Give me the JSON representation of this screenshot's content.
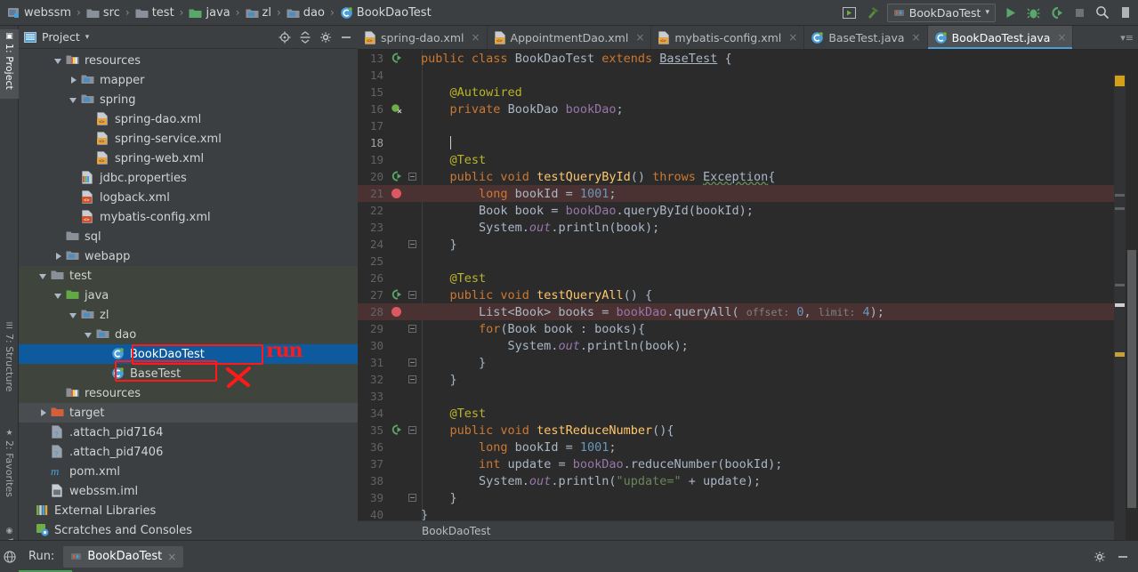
{
  "window": {
    "breadcrumbs": [
      {
        "label": "webssm",
        "icon": "module-icon"
      },
      {
        "label": "src",
        "icon": "folder-icon"
      },
      {
        "label": "test",
        "icon": "folder-icon"
      },
      {
        "label": "java",
        "icon": "source-folder-icon"
      },
      {
        "label": "zl",
        "icon": "package-icon"
      },
      {
        "label": "dao",
        "icon": "package-icon"
      },
      {
        "label": "BookDaoTest",
        "icon": "java-class-icon"
      }
    ],
    "separator": "›"
  },
  "toolbar": {
    "run_configuration": "BookDaoTest",
    "dropdown_glyph": "▾",
    "buttons": [
      {
        "name": "select-run-config-icon",
        "label": ""
      },
      {
        "name": "build-hammer-icon",
        "label": ""
      },
      {
        "name": "run-button",
        "label": "Run"
      },
      {
        "name": "debug-button",
        "label": "Debug"
      },
      {
        "name": "run-with-coverage-button",
        "label": "Run with Coverage"
      },
      {
        "name": "stop-button",
        "label": "Stop"
      },
      {
        "name": "search-everywhere-icon",
        "label": "Search"
      }
    ]
  },
  "left_tool_strip": [
    {
      "label": "1: Project",
      "selected": true
    },
    {
      "label": "7: Structure",
      "selected": false
    },
    {
      "label": "2: Favorites",
      "selected": false
    },
    {
      "label": "Web",
      "selected": false
    }
  ],
  "project_panel": {
    "title": "Project",
    "dropdown_glyph": "▾",
    "actions": [
      "locate-icon",
      "collapse-all-icon",
      "settings-gear-icon",
      "hide-icon"
    ],
    "tree": [
      {
        "label": "resources",
        "indent": 2,
        "arrow": "open",
        "icon": "resource-folder-icon"
      },
      {
        "label": "mapper",
        "indent": 3,
        "arrow": "closed",
        "icon": "package-folder-icon"
      },
      {
        "label": "spring",
        "indent": 3,
        "arrow": "open",
        "icon": "package-folder-icon"
      },
      {
        "label": "spring-dao.xml",
        "indent": 4,
        "arrow": "none",
        "icon": "xml-file-icon"
      },
      {
        "label": "spring-service.xml",
        "indent": 4,
        "arrow": "none",
        "icon": "xml-file-icon"
      },
      {
        "label": "spring-web.xml",
        "indent": 4,
        "arrow": "none",
        "icon": "xml-file-icon"
      },
      {
        "label": "jdbc.properties",
        "indent": 3,
        "arrow": "none",
        "icon": "properties-file-icon"
      },
      {
        "label": "logback.xml",
        "indent": 3,
        "arrow": "none",
        "icon": "xml-file-red-icon"
      },
      {
        "label": "mybatis-config.xml",
        "indent": 3,
        "arrow": "none",
        "icon": "xml-file-red-icon"
      },
      {
        "label": "sql",
        "indent": 2,
        "arrow": "none",
        "icon": "folder-icon"
      },
      {
        "label": "webapp",
        "indent": 2,
        "arrow": "closed",
        "icon": "package-folder-icon"
      },
      {
        "label": "test",
        "indent": 1,
        "arrow": "open",
        "icon": "folder-icon"
      },
      {
        "label": "java",
        "indent": 2,
        "arrow": "open",
        "icon": "test-source-folder-icon"
      },
      {
        "label": "zl",
        "indent": 3,
        "arrow": "open",
        "icon": "package-folder-icon"
      },
      {
        "label": "dao",
        "indent": 4,
        "arrow": "open",
        "icon": "package-folder-icon"
      },
      {
        "label": "BookDaoTest",
        "indent": 5,
        "arrow": "none",
        "icon": "java-class-icon",
        "state": "selected"
      },
      {
        "label": "BaseTest",
        "indent": 5,
        "arrow": "none",
        "icon": "java-class-icon",
        "state": "highlighted"
      },
      {
        "label": "resources",
        "indent": 2,
        "arrow": "none",
        "icon": "resource-folder-icon"
      },
      {
        "label": "target",
        "indent": 1,
        "arrow": "closed",
        "icon": "excluded-folder-icon"
      },
      {
        "label": ".attach_pid7164",
        "indent": 1,
        "arrow": "none",
        "icon": "unknown-file-icon"
      },
      {
        "label": ".attach_pid7406",
        "indent": 1,
        "arrow": "none",
        "icon": "unknown-file-icon"
      },
      {
        "label": "pom.xml",
        "indent": 1,
        "arrow": "none",
        "icon": "maven-file-icon"
      },
      {
        "label": "webssm.iml",
        "indent": 1,
        "arrow": "none",
        "icon": "iml-file-icon"
      },
      {
        "label": "External Libraries",
        "indent": 0,
        "arrow": "none",
        "icon": "libraries-icon"
      },
      {
        "label": "Scratches and Consoles",
        "indent": 0,
        "arrow": "none",
        "icon": "scratches-icon"
      }
    ]
  },
  "annotations": {
    "run_text": "run",
    "cross_mark": "✕",
    "color": "#ff1a1a"
  },
  "editor": {
    "tabs": [
      {
        "label": "spring-dao.xml",
        "icon": "xml-file-icon",
        "active": false
      },
      {
        "label": "AppointmentDao.xml",
        "icon": "xml-file-icon",
        "active": false
      },
      {
        "label": "mybatis-config.xml",
        "icon": "xml-file-icon",
        "active": false
      },
      {
        "label": "BaseTest.java",
        "icon": "java-class-icon",
        "active": false
      },
      {
        "label": "BookDaoTest.java",
        "icon": "java-class-icon",
        "active": true
      }
    ],
    "close_glyph": "×",
    "tab_overflow_glyph": "▾≡",
    "bottom_breadcrumb": "BookDaoTest",
    "lines": [
      {
        "num": "13",
        "gutter": "run-method",
        "text_html": "<span class='kw'>public class</span> <span class='cls'>BookDaoTest</span> <span class='kw'>extends</span> <span class='undl'>BaseTest</span> {"
      },
      {
        "num": "14",
        "gutter": "",
        "text_html": ""
      },
      {
        "num": "15",
        "gutter": "",
        "text_html": "    <span class='ann'>@Autowired</span>"
      },
      {
        "num": "16",
        "gutter": "bean",
        "text_html": "    <span class='kw'>private</span> <span class='cls'>BookDao</span> <span class='fld'>bookDao</span>;"
      },
      {
        "num": "17",
        "gutter": "",
        "text_html": ""
      },
      {
        "num": "18",
        "gutter": "",
        "current": true,
        "text_html": "    <span class='caret'></span>"
      },
      {
        "num": "19",
        "gutter": "",
        "text_html": "    <span class='ann'>@Test</span>"
      },
      {
        "num": "20",
        "gutter": "run-method fold",
        "text_html": "    <span class='kw'>public void</span> <span class='fn'>testQueryById</span>() <span class='kw'>throws</span> <span class='werr'>Exception</span>{"
      },
      {
        "num": "21",
        "gutter": "breakpoint",
        "bp": true,
        "text_html": "        <span class='kw'>long</span> bookId = <span class='num'>1001</span>;"
      },
      {
        "num": "22",
        "gutter": "",
        "text_html": "        Book book = <span class='fld'>bookDao</span>.queryById(bookId);"
      },
      {
        "num": "23",
        "gutter": "",
        "text_html": "        System.<span class='stat'>out</span>.println(book);"
      },
      {
        "num": "24",
        "gutter": "fold",
        "text_html": "    }"
      },
      {
        "num": "25",
        "gutter": "",
        "text_html": ""
      },
      {
        "num": "26",
        "gutter": "",
        "text_html": "    <span class='ann'>@Test</span>"
      },
      {
        "num": "27",
        "gutter": "run-method fold",
        "text_html": "    <span class='kw'>public void</span> <span class='fn'>testQueryAll</span>() {"
      },
      {
        "num": "28",
        "gutter": "breakpoint",
        "bp": true,
        "text_html": "        List&lt;Book&gt; books = <span class='fld'>bookDao</span>.queryAll( <span class='hint'>offset:</span> <span class='num'>0</span>, <span class='hint'>limit:</span> <span class='num'>4</span>);"
      },
      {
        "num": "29",
        "gutter": "fold",
        "text_html": "        <span class='kw'>for</span>(Book book : books){"
      },
      {
        "num": "30",
        "gutter": "",
        "text_html": "            System.<span class='stat'>out</span>.println(book);"
      },
      {
        "num": "31",
        "gutter": "fold",
        "text_html": "        }"
      },
      {
        "num": "32",
        "gutter": "fold",
        "text_html": "    }"
      },
      {
        "num": "33",
        "gutter": "",
        "text_html": ""
      },
      {
        "num": "34",
        "gutter": "",
        "text_html": "    <span class='ann'>@Test</span>"
      },
      {
        "num": "35",
        "gutter": "run-method fold",
        "text_html": "    <span class='kw'>public void</span> <span class='fn'>testReduceNumber</span>(){"
      },
      {
        "num": "36",
        "gutter": "",
        "text_html": "        <span class='kw'>long</span> bookId = <span class='num'>1001</span>;"
      },
      {
        "num": "37",
        "gutter": "",
        "text_html": "        <span class='kw'>int</span> update = <span class='fld'>bookDao</span>.reduceNumber(bookId);"
      },
      {
        "num": "38",
        "gutter": "",
        "text_html": "        System.<span class='stat'>out</span>.println(<span class='str'>\"update=\"</span> + update);"
      },
      {
        "num": "39",
        "gutter": "fold",
        "text_html": "    }"
      },
      {
        "num": "40",
        "gutter": "",
        "text_html": "}"
      }
    ]
  },
  "run_panel": {
    "label": "Run:",
    "tab_label": "BookDaoTest",
    "close_glyph": "×",
    "actions": [
      "settings-gear-icon",
      "hide-icon"
    ]
  },
  "colors": {
    "background": "#3c3f41",
    "editor_background": "#2b2b2b",
    "selection_blue": "#0d5a9e",
    "accent_blue": "#4a9fd8",
    "breakpoint_red": "#db5860",
    "annotation_red": "#ff1a1a",
    "run_green": "#499c54"
  }
}
